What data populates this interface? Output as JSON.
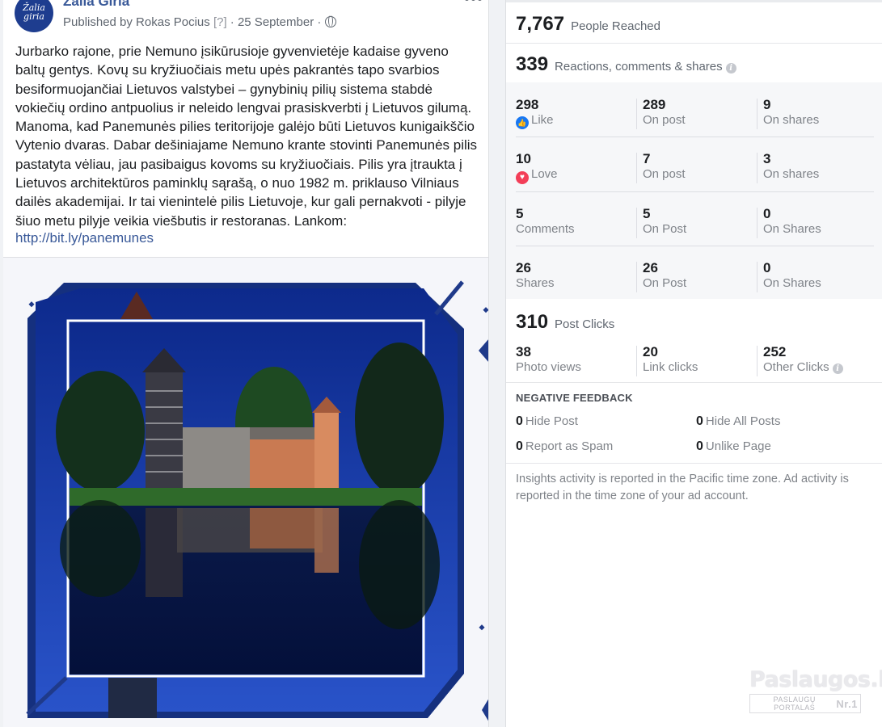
{
  "post": {
    "page_name": "Žalia Giria",
    "avatar_text": "Žalia giria",
    "published_by": "Published by Rokas Pocius",
    "q_mark": "[?]",
    "date": "· 25 September ·",
    "text": "Jurbarko rajone, prie Nemuno įsikūrusioje gyvenvietėje kadaise gyveno baltų gentys. Kovų su kryžiuočiais metu upės pakrantės tapo svarbios besiformuojančiai Lietuvos valstybei – gynybinių pilių sistema stabdė vokiečių ordino antpuolius ir neleido lengvai prasiskverbti į Lietuvos gilumą. Manoma, kad Panemunės pilies teritorijoje galėjo būti Lietuvos kunigaikščio Vytenio dvaras. Dabar dešiniajame Nemuno krante stovinti Panemunės pilis pastatyta vėliau, jau pasibaigus kovoms su kryžiuočiais. Pilis yra įtraukta į Lietuvos architektūros paminklų sąrašą, o nuo 1982 m. priklauso Vilniaus dailės akademijai. Ir tai vienintelė pilis Lietuvoje, kur gali pernakvoti - pilyje šiuo metu pilyje veikia viešbutis ir restoranas. Lankom:",
    "link": "http://bit.ly/panemunes"
  },
  "insights": {
    "reached": {
      "num": "7,767",
      "label": "People Reached"
    },
    "engagement": {
      "num": "339",
      "label": "Reactions, comments & shares"
    },
    "rows": [
      {
        "a_num": "298",
        "a_lbl": "Like",
        "b_num": "289",
        "b_lbl": "On post",
        "c_num": "9",
        "c_lbl": "On shares"
      },
      {
        "a_num": "10",
        "a_lbl": "Love",
        "b_num": "7",
        "b_lbl": "On post",
        "c_num": "3",
        "c_lbl": "On shares"
      },
      {
        "a_num": "5",
        "a_lbl": "Comments",
        "b_num": "5",
        "b_lbl": "On Post",
        "c_num": "0",
        "c_lbl": "On Shares"
      },
      {
        "a_num": "26",
        "a_lbl": "Shares",
        "b_num": "26",
        "b_lbl": "On Post",
        "c_num": "0",
        "c_lbl": "On Shares"
      }
    ],
    "clicks": {
      "num": "310",
      "label": "Post Clicks"
    },
    "click_row": {
      "a_num": "38",
      "a_lbl": "Photo views",
      "b_num": "20",
      "b_lbl": "Link clicks",
      "c_num": "252",
      "c_lbl": "Other Clicks"
    },
    "negative": {
      "title": "NEGATIVE FEEDBACK",
      "hide_post": {
        "num": "0",
        "label": "Hide Post"
      },
      "hide_all": {
        "num": "0",
        "label": "Hide All Posts"
      },
      "spam": {
        "num": "0",
        "label": "Report as Spam"
      },
      "unlike": {
        "num": "0",
        "label": "Unlike Page"
      }
    },
    "footnote": "Insights activity is reported in the Pacific time zone. Ad activity is reported in the time zone of your ad account."
  },
  "watermark": {
    "brand": "Paslaugos.lt",
    "sub": "PASLAUGŲ PORTALAS",
    "badge": "Nr.1"
  },
  "icons": {
    "like": "thumbs-up-icon",
    "love": "heart-icon",
    "info": "info-icon",
    "globe": "globe-icon",
    "more": "more-dots-icon"
  },
  "colors": {
    "link": "#385898",
    "like": "#1877f2",
    "love": "#f33e58",
    "photo_frame": "#1f3a8a"
  }
}
